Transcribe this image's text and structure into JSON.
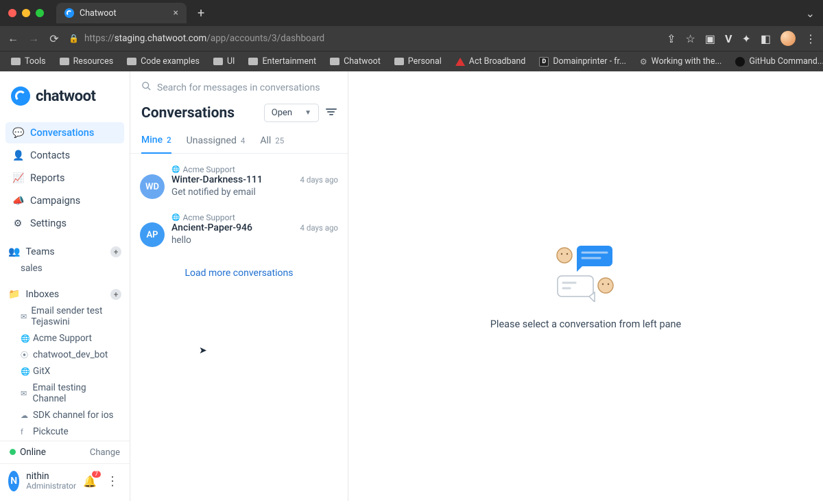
{
  "browser": {
    "tab_title": "Chatwoot",
    "url_prefix": "https://",
    "url_host": "staging.chatwoot.com",
    "url_path": "/app/accounts/3/dashboard",
    "bookmarks": [
      "Tools",
      "Resources",
      "Code examples",
      "UI",
      "Entertainment",
      "Chatwoot",
      "Personal",
      "Act Broadband",
      "Domainprinter - fr...",
      "Working with the...",
      "GitHub Command..."
    ]
  },
  "brand": "chatwoot",
  "nav": {
    "items": [
      {
        "label": "Conversations",
        "active": true,
        "icon": "chat"
      },
      {
        "label": "Contacts",
        "active": false,
        "icon": "person"
      },
      {
        "label": "Reports",
        "active": false,
        "icon": "trend"
      },
      {
        "label": "Campaigns",
        "active": false,
        "icon": "megaphone"
      },
      {
        "label": "Settings",
        "active": false,
        "icon": "gear"
      }
    ],
    "teams_label": "Teams",
    "teams": [
      "sales"
    ],
    "inboxes_label": "Inboxes",
    "inboxes": [
      {
        "label": "Email sender test Tejaswini",
        "icon": "mail"
      },
      {
        "label": "Acme Support",
        "icon": "globe"
      },
      {
        "label": "chatwoot_dev_bot",
        "icon": "bot"
      },
      {
        "label": "GitX",
        "icon": "globe"
      },
      {
        "label": "Email testing Channel",
        "icon": "mail"
      },
      {
        "label": "SDK channel for ios",
        "icon": "cloud"
      },
      {
        "label": "Pickcute",
        "icon": "fb"
      }
    ]
  },
  "presence": {
    "status": "Online",
    "change": "Change"
  },
  "user": {
    "initial": "N",
    "name": "nithin",
    "role": "Administrator",
    "notif_count": "7"
  },
  "list": {
    "search_placeholder": "Search for messages in conversations",
    "title": "Conversations",
    "status_filter": "Open",
    "tabs": [
      {
        "label": "Mine",
        "count": "2",
        "active": true
      },
      {
        "label": "Unassigned",
        "count": "4",
        "active": false
      },
      {
        "label": "All",
        "count": "25",
        "active": false
      }
    ],
    "items": [
      {
        "channel": "Acme Support",
        "name": "Winter-Darkness-111",
        "snippet": "Get notified by email",
        "time": "4 days ago",
        "initials": "WD",
        "color": "#6aa9f2"
      },
      {
        "channel": "Acme Support",
        "name": "Ancient-Paper-946",
        "snippet": "hello",
        "time": "4 days ago",
        "initials": "AP",
        "color": "#3f9cf4"
      }
    ],
    "load_more": "Load more conversations"
  },
  "empty_text": "Please select a conversation from left pane"
}
